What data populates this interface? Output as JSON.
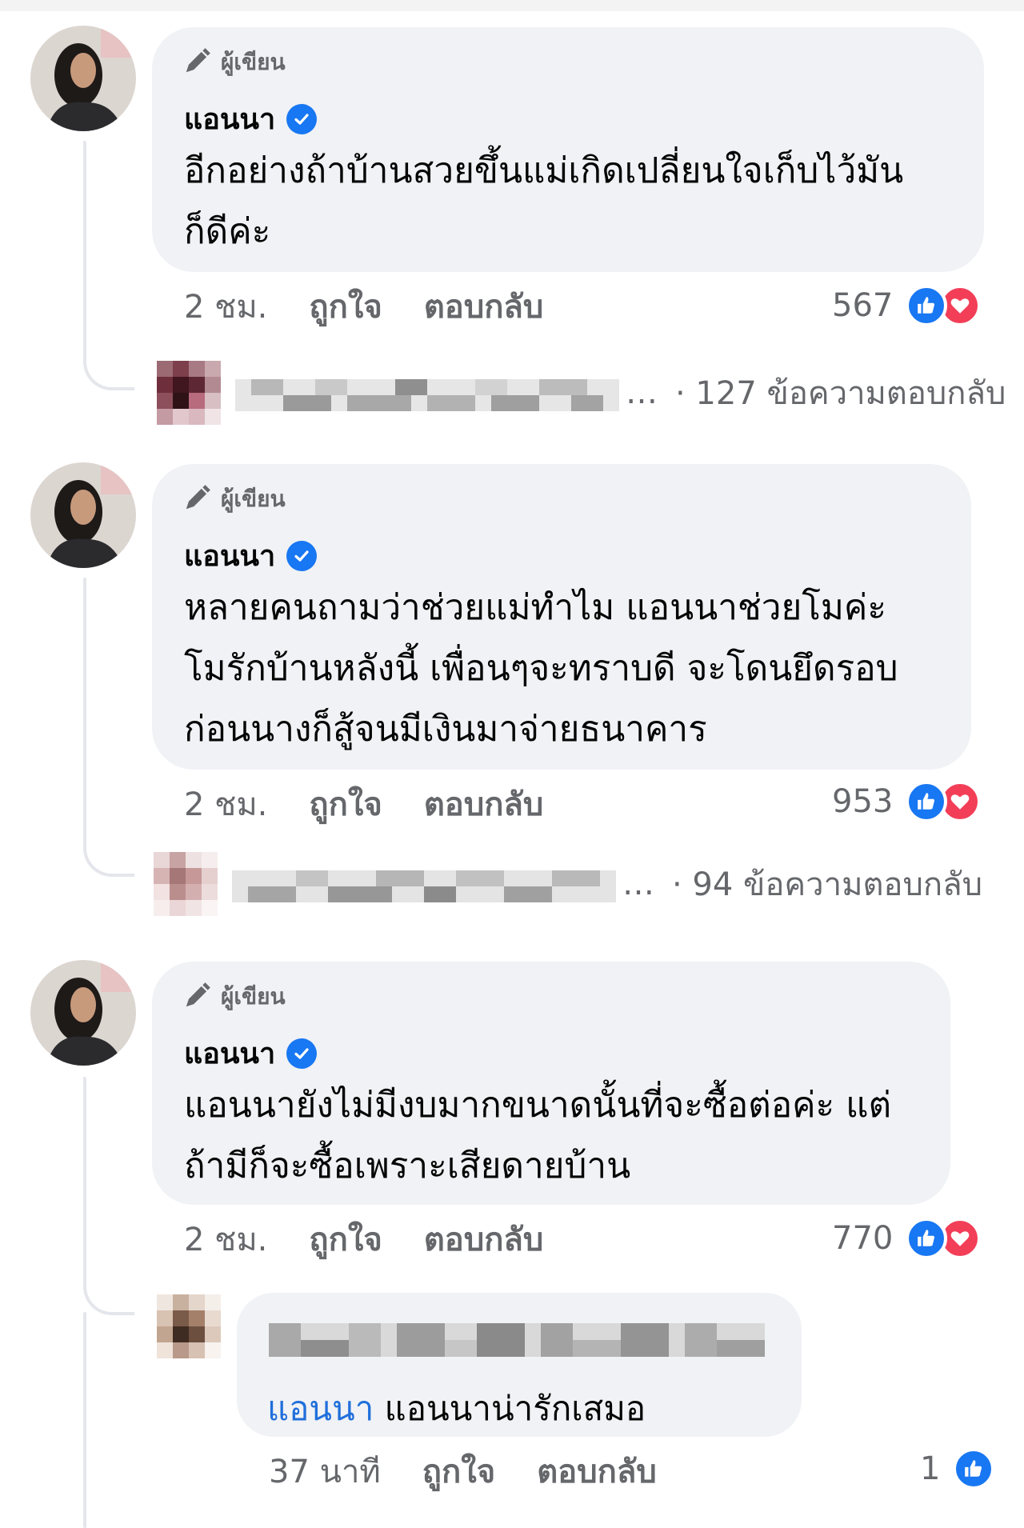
{
  "comments": [
    {
      "author_label": "ผู้เขียน",
      "name": "แอนนา",
      "text_lines": [
        "อีกอย่างถ้าบ้านสวยขึ้นแม่เกิดเปลี่ยนใจเก็บไว้มัน",
        "ก็ดีค่ะ"
      ],
      "time": "2 ชม.",
      "like_label": "ถูกใจ",
      "reply_label": "ตอบกลับ",
      "reaction_count": "567",
      "reactions": [
        "like-icon",
        "love-icon"
      ],
      "reply_count_text": "· 127 ข้อความตอบกลับ"
    },
    {
      "author_label": "ผู้เขียน",
      "name": "แอนนา",
      "text_lines": [
        "หลายคนถามว่าช่วยแม่ทำไม แอนนาช่วยโมค่ะ",
        "โมรักบ้านหลังนี้ เพื่อนๆจะทราบดี จะโดนยึดรอบ",
        "ก่อนนางก็สู้จนมีเงินมาจ่ายธนาคาร"
      ],
      "time": "2 ชม.",
      "like_label": "ถูกใจ",
      "reply_label": "ตอบกลับ",
      "reaction_count": "953",
      "reactions": [
        "like-icon",
        "love-icon"
      ],
      "reply_count_text": "· 94 ข้อความตอบกลับ"
    },
    {
      "author_label": "ผู้เขียน",
      "name": "แอนนา",
      "text_lines": [
        "แอนนายังไม่มีงบมากขนาดนั้นที่จะซื้อต่อค่ะ แต่",
        "ถ้ามีก็จะซื้อเพราะเสียดายบ้าน"
      ],
      "time": "2 ชม.",
      "like_label": "ถูกใจ",
      "reply_label": "ตอบกลับ",
      "reaction_count": "770",
      "reactions": [
        "like-icon",
        "love-icon"
      ]
    }
  ],
  "reply_preview_ellipsis": [
    "…",
    "…"
  ],
  "reply": {
    "mention": "แอนนา",
    "text": "แอนนาน่ารักเสมอ",
    "time": "37 นาที",
    "like_label": "ถูกใจ",
    "reply_label": "ตอบกลับ",
    "reaction_count": "1",
    "reactions": [
      "like-icon"
    ]
  },
  "colors": {
    "bubble": "#f0f2f5",
    "accent_blue": "#1877f2",
    "mention_blue": "#216fdb",
    "love_red": "#f33e58",
    "secondary_text": "#65676b"
  }
}
